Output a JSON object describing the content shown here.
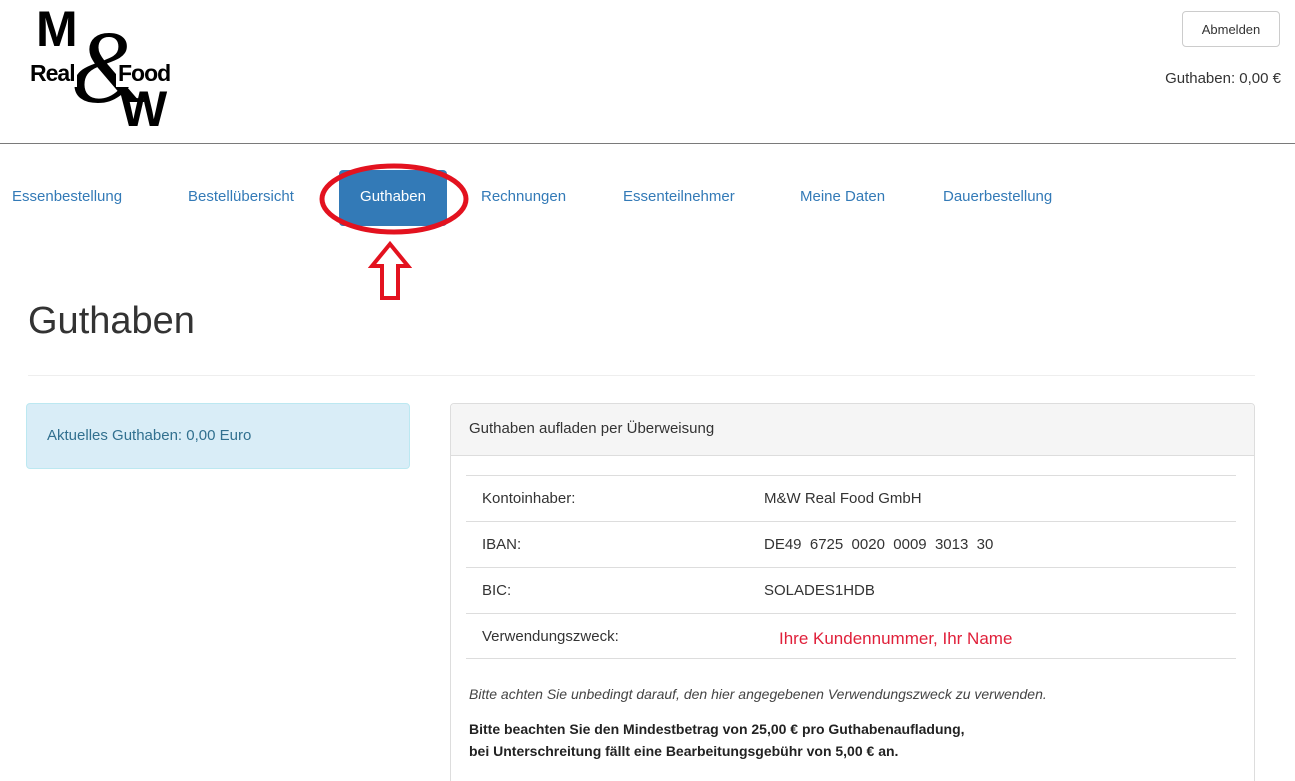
{
  "brand": {
    "logo_top": "M",
    "logo_amp": "&",
    "logo_left": "Real",
    "logo_right": "Food",
    "logo_bottom": "W"
  },
  "header": {
    "logout_label": "Abmelden",
    "balance_text": "Guthaben: 0,00 €"
  },
  "nav": {
    "items": [
      {
        "label": "Essenbestellung",
        "active": false
      },
      {
        "label": "Bestellübersicht",
        "active": false
      },
      {
        "label": "Guthaben",
        "active": true
      },
      {
        "label": "Rechnungen",
        "active": false
      },
      {
        "label": "Essenteilnehmer",
        "active": false
      },
      {
        "label": "Meine Daten",
        "active": false
      },
      {
        "label": "Dauerbestellung",
        "active": false
      }
    ]
  },
  "annotation": {
    "color": "#e3121f",
    "marker": "highlight-ellipse",
    "pointer": "up-arrow-icon"
  },
  "main": {
    "title": "Guthaben",
    "current_balance": "Aktuelles Guthaben: 0,00 Euro",
    "panel": {
      "heading": "Guthaben aufladen per Überweisung",
      "rows": [
        {
          "label": "Kontoinhaber:",
          "value": "M&W Real Food GmbH"
        },
        {
          "label": "IBAN:",
          "value": "DE49  6725  0020  0009  3013  30"
        },
        {
          "label": "BIC:",
          "value": "SOLADES1HDB"
        },
        {
          "label": "Verwendungszweck:",
          "value": "Ihre Kundennummer, Ihr Name"
        }
      ],
      "note_italic": "Bitte achten Sie unbedingt darauf, den hier angegebenen Verwendungszweck zu verwenden.",
      "note_bold_line1": "Bitte beachten Sie den Mindestbetrag von 25,00 € pro Guthabenaufladung,",
      "note_bold_line2": "bei Unterschreitung fällt eine Bearbeitungsgebühr von 5,00 € an."
    }
  },
  "colors": {
    "link": "#337ab7",
    "active_bg": "#337ab7",
    "info_bg": "#d9edf7",
    "info_text": "#31708f",
    "red_text": "#e0203a"
  }
}
